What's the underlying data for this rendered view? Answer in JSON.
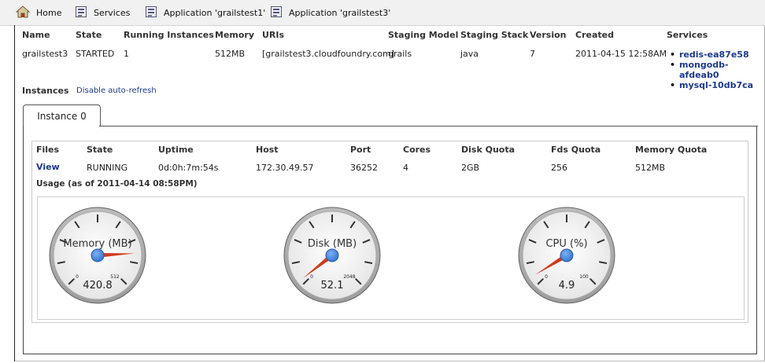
{
  "topbar": {
    "tabs": [
      {
        "label": "Home",
        "icon": "home-icon"
      },
      {
        "label": "Services",
        "icon": "services-icon"
      },
      {
        "label": "Application 'grailstest1'",
        "icon": "application-icon"
      },
      {
        "label": "Application 'grailstest3'",
        "icon": "application-icon"
      }
    ]
  },
  "app_table": {
    "headers": {
      "name": "Name",
      "state": "State",
      "running": "Running Instances",
      "memory": "Memory",
      "uris": "URIs",
      "staging_model": "Staging Model",
      "staging_stack": "Staging Stack",
      "version": "Version",
      "created": "Created",
      "services": "Services"
    },
    "row": {
      "name": "grailstest3",
      "state": "STARTED",
      "running": "1",
      "memory": "512MB",
      "uris": "[grailstest3.cloudfoundry.com]",
      "staging_model": "grails",
      "staging_stack": "java",
      "version": "7",
      "created": "2011-04-15 12:58AM",
      "services": [
        "redis-ea87e58",
        "mongodb-afdeab0",
        "mysql-10db7ca"
      ]
    }
  },
  "instances": {
    "label": "Instances",
    "refresh_link": "Disable auto-refresh",
    "tab_label": "Instance 0"
  },
  "instance_table": {
    "headers": {
      "files": "Files",
      "state": "State",
      "uptime": "Uptime",
      "host": "Host",
      "port": "Port",
      "cores": "Cores",
      "disk_quota": "Disk Quota",
      "fds_quota": "Fds Quota",
      "memory_quota": "Memory Quota"
    },
    "row": {
      "files": "View",
      "state": "RUNNING",
      "uptime": "0d:0h:7m:54s",
      "host": "172.30.49.57",
      "port": "36252",
      "cores": "4",
      "disk_quota": "2GB",
      "fds_quota": "256",
      "memory_quota": "512MB"
    }
  },
  "usage": {
    "title": "Usage (as of 2011-04-14 08:58PM)",
    "gauges": [
      {
        "title": "Memory (MB)",
        "min_label": "0",
        "max_label": "512",
        "min": 0,
        "max": 512,
        "value": 420.8,
        "display": "420.8"
      },
      {
        "title": "Disk (MB)",
        "min_label": "0",
        "max_label": "2048",
        "min": 0,
        "max": 2048,
        "value": 52.1,
        "display": "52.1"
      },
      {
        "title": "CPU (%)",
        "min_label": "0",
        "max_label": "100",
        "min": 0,
        "max": 100,
        "value": 4.9,
        "display": "4.9"
      }
    ]
  },
  "colors": {
    "link": "#1a3a8f",
    "needle": "#d23a1a",
    "hub": "#3a7bd5"
  }
}
